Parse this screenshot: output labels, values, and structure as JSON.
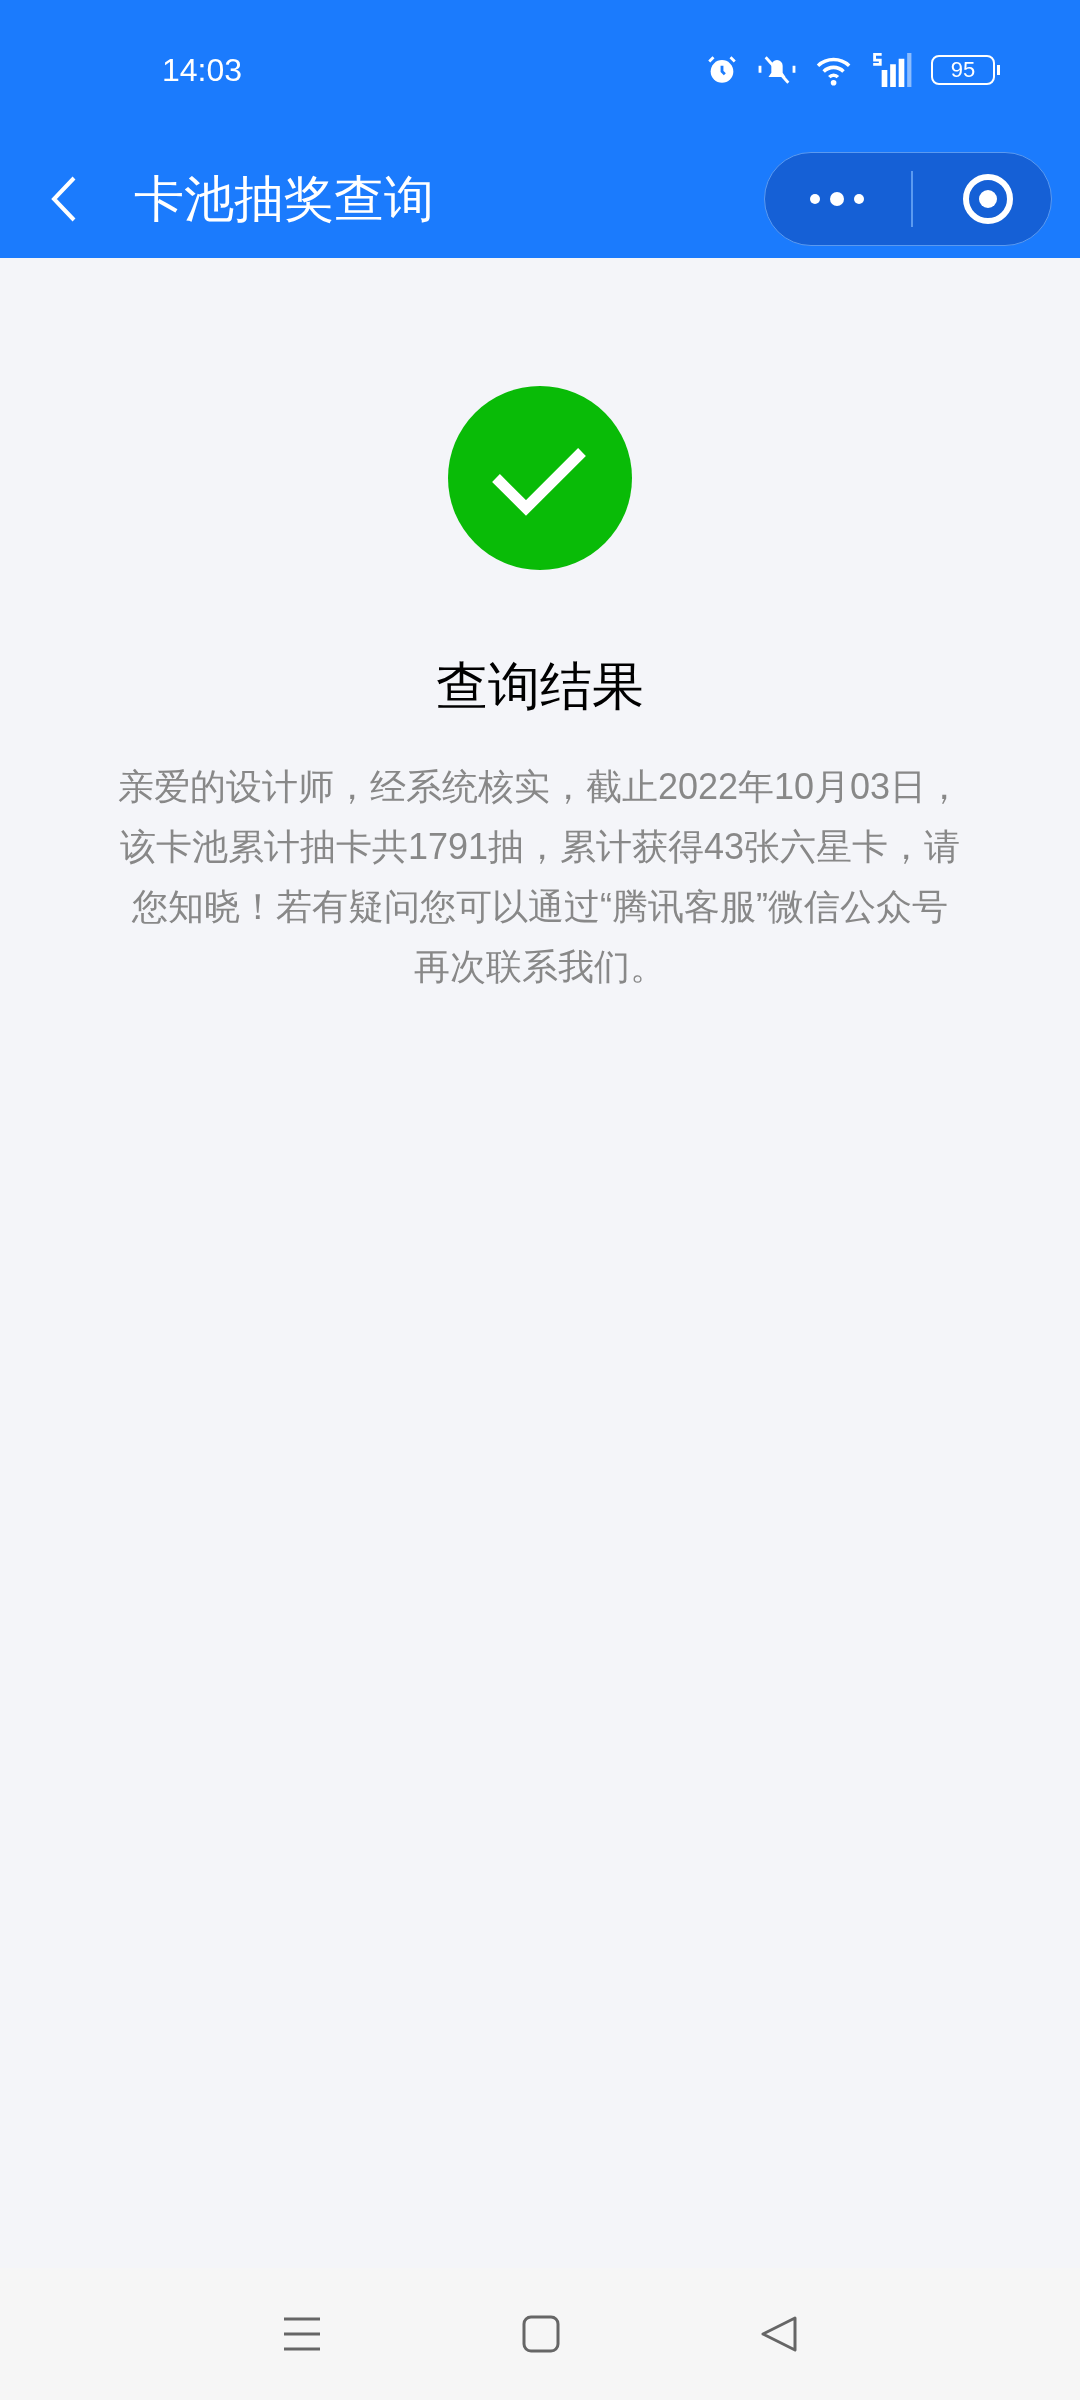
{
  "status_bar": {
    "time": "14:03",
    "battery": "95"
  },
  "nav_bar": {
    "title": "卡池抽奖查询"
  },
  "result": {
    "success": true,
    "title": "查询结果",
    "message": "亲爱的设计师，经系统核实，截止2022年10月03日，该卡池累计抽卡共1791抽，累计获得43张六星卡，请您知晓！若有疑问您可以通过“腾讯客服”微信公众号再次联系我们。"
  }
}
